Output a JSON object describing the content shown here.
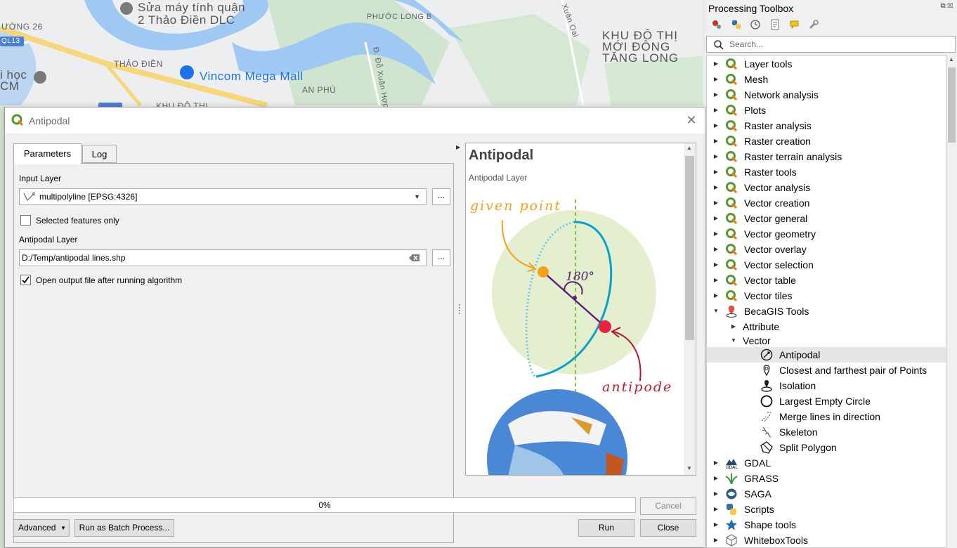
{
  "map": {
    "labels": {
      "road_26": "ƯỜNG 26",
      "ql13": "QL13",
      "sua_may": "Sửa máy tính quận",
      "thao_dien_dlc": "2 Thảo Điền DLC",
      "phuoc_long_b": "PHƯỚC LONG B",
      "xuan_oai": "Xuân Oai",
      "khu_do_thi": "KHU ĐÔ THỊ",
      "moi_dong": "MỚI ĐÔNG",
      "tang_long": "TĂNG LONG",
      "thao_dien": "THẢO ĐIỀN",
      "vincom": "Vincom Mega Mall",
      "an_phu": "AN PHÚ",
      "do_xuan_hop": "Đ. Đỗ Xuân Hợp",
      "hoc": "i học",
      "cm": "CM",
      "khu_do_thi_bottom": "KHU ĐÔ THỊ"
    }
  },
  "dialog": {
    "title": "Antipodal",
    "tabs": {
      "parameters": "Parameters",
      "log": "Log"
    },
    "input_layer_label": "Input Layer",
    "input_layer_value": "multipolyline [EPSG:4326]",
    "selected_only_label": "Selected features only",
    "selected_only_checked": false,
    "antipodal_layer_label": "Antipodal Layer",
    "antipodal_layer_value": "D:/Temp/antipodal lines.shp",
    "open_output_label": "Open output file after running algorithm",
    "open_output_checked": true,
    "dots": "...",
    "help": {
      "title": "Antipodal",
      "subtitle": "Antipodal Layer",
      "given_point": "given point",
      "angle": "180°",
      "antipode": "antipode"
    },
    "progress_text": "0%",
    "progress_value": 0,
    "buttons": {
      "cancel": "Cancel",
      "advanced": "Advanced",
      "batch": "Run as Batch Process...",
      "run": "Run",
      "close": "Close"
    }
  },
  "toolbox": {
    "title": "Processing Toolbox",
    "search_placeholder": "Search...",
    "items": [
      {
        "label": "Layer tools",
        "icon": "qgis-icon",
        "level": 0,
        "expanded": false
      },
      {
        "label": "Mesh",
        "icon": "qgis-icon",
        "level": 0,
        "expanded": false
      },
      {
        "label": "Network analysis",
        "icon": "qgis-icon",
        "level": 0,
        "expanded": false
      },
      {
        "label": "Plots",
        "icon": "qgis-icon",
        "level": 0,
        "expanded": false
      },
      {
        "label": "Raster analysis",
        "icon": "qgis-icon",
        "level": 0,
        "expanded": false
      },
      {
        "label": "Raster creation",
        "icon": "qgis-icon",
        "level": 0,
        "expanded": false
      },
      {
        "label": "Raster terrain analysis",
        "icon": "qgis-icon",
        "level": 0,
        "expanded": false
      },
      {
        "label": "Raster tools",
        "icon": "qgis-icon",
        "level": 0,
        "expanded": false
      },
      {
        "label": "Vector analysis",
        "icon": "qgis-icon",
        "level": 0,
        "expanded": false
      },
      {
        "label": "Vector creation",
        "icon": "qgis-icon",
        "level": 0,
        "expanded": false
      },
      {
        "label": "Vector general",
        "icon": "qgis-icon",
        "level": 0,
        "expanded": false
      },
      {
        "label": "Vector geometry",
        "icon": "qgis-icon",
        "level": 0,
        "expanded": false
      },
      {
        "label": "Vector overlay",
        "icon": "qgis-icon",
        "level": 0,
        "expanded": false
      },
      {
        "label": "Vector selection",
        "icon": "qgis-icon",
        "level": 0,
        "expanded": false
      },
      {
        "label": "Vector table",
        "icon": "qgis-icon",
        "level": 0,
        "expanded": false
      },
      {
        "label": "Vector tiles",
        "icon": "qgis-icon",
        "level": 0,
        "expanded": false
      },
      {
        "label": "BecaGIS Tools",
        "icon": "becagis-icon",
        "level": 0,
        "expanded": true
      },
      {
        "label": "Attribute",
        "icon": "",
        "level": 1,
        "expanded": false
      },
      {
        "label": "Vector",
        "icon": "",
        "level": 1,
        "expanded": true
      },
      {
        "label": "Antipodal",
        "icon": "antipodal-icon",
        "level": 2,
        "leaf": true,
        "selected": true
      },
      {
        "label": "Closest and farthest pair of Points",
        "icon": "closest-points-icon",
        "level": 2,
        "leaf": true
      },
      {
        "label": "Isolation",
        "icon": "isolation-icon",
        "level": 2,
        "leaf": true
      },
      {
        "label": "Largest Empty Circle",
        "icon": "circle-icon",
        "level": 2,
        "leaf": true
      },
      {
        "label": "Merge lines in direction",
        "icon": "merge-lines-icon",
        "level": 2,
        "leaf": true
      },
      {
        "label": "Skeleton",
        "icon": "skeleton-icon",
        "level": 2,
        "leaf": true
      },
      {
        "label": "Split Polygon",
        "icon": "split-polygon-icon",
        "level": 2,
        "leaf": true
      },
      {
        "label": "GDAL",
        "icon": "gdal-icon",
        "level": 0,
        "expanded": false
      },
      {
        "label": "GRASS",
        "icon": "grass-icon",
        "level": 0,
        "expanded": false
      },
      {
        "label": "SAGA",
        "icon": "saga-icon",
        "level": 0,
        "expanded": false
      },
      {
        "label": "Scripts",
        "icon": "python-icon",
        "level": 0,
        "expanded": false
      },
      {
        "label": "Shape tools",
        "icon": "star-icon",
        "level": 0,
        "expanded": false
      },
      {
        "label": "WhiteboxTools",
        "icon": "cube-icon",
        "level": 0,
        "expanded": false
      }
    ]
  }
}
